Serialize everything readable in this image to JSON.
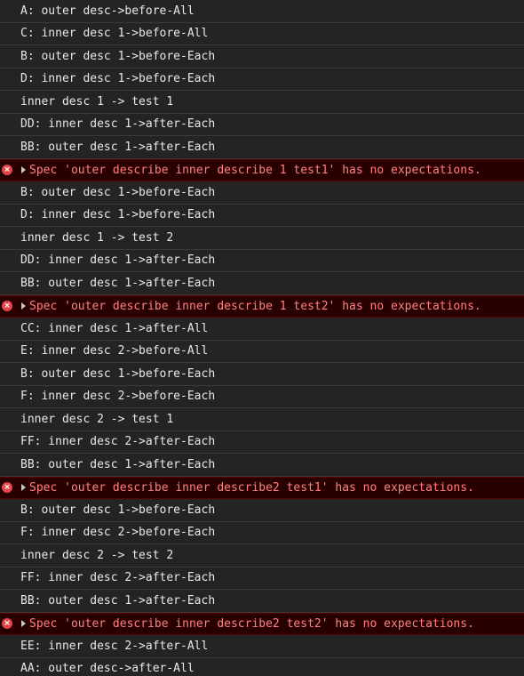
{
  "icons": {
    "error": "error-circle-icon",
    "expand": "triangle-right-icon",
    "error_glyph": "×"
  },
  "colors": {
    "background": "#242424",
    "log_text": "#e8e8e8",
    "error_background": "#290000",
    "error_text": "#ff8080",
    "error_icon": "#e0474c",
    "separator": "#3a3a3a"
  },
  "console": {
    "rows": [
      {
        "type": "log",
        "text": "A: outer desc->before-All"
      },
      {
        "type": "log",
        "text": "C: inner desc 1->before-All"
      },
      {
        "type": "log",
        "text": "B: outer desc 1->before-Each"
      },
      {
        "type": "log",
        "text": "D: inner desc 1->before-Each"
      },
      {
        "type": "log",
        "text": "inner desc 1 -> test 1"
      },
      {
        "type": "log",
        "text": "DD: inner desc 1->after-Each"
      },
      {
        "type": "log",
        "text": "BB: outer desc 1->after-Each"
      },
      {
        "type": "error",
        "text": "Spec 'outer describe inner describe 1 test1' has no expectations."
      },
      {
        "type": "log",
        "text": "B: outer desc 1->before-Each"
      },
      {
        "type": "log",
        "text": "D: inner desc 1->before-Each"
      },
      {
        "type": "log",
        "text": "inner desc 1 -> test 2"
      },
      {
        "type": "log",
        "text": "DD: inner desc 1->after-Each"
      },
      {
        "type": "log",
        "text": "BB: outer desc 1->after-Each"
      },
      {
        "type": "error",
        "text": "Spec 'outer describe inner describe 1 test2' has no expectations."
      },
      {
        "type": "log",
        "text": "CC: inner desc 1->after-All"
      },
      {
        "type": "log",
        "text": "E: inner desc 2->before-All"
      },
      {
        "type": "log",
        "text": "B: outer desc 1->before-Each"
      },
      {
        "type": "log",
        "text": "F: inner desc 2->before-Each"
      },
      {
        "type": "log",
        "text": "inner desc 2 -> test 1"
      },
      {
        "type": "log",
        "text": "FF: inner desc 2->after-Each"
      },
      {
        "type": "log",
        "text": "BB: outer desc 1->after-Each"
      },
      {
        "type": "error",
        "text": "Spec 'outer describe inner describe2 test1' has no expectations."
      },
      {
        "type": "log",
        "text": "B: outer desc 1->before-Each"
      },
      {
        "type": "log",
        "text": "F: inner desc 2->before-Each"
      },
      {
        "type": "log",
        "text": "inner desc 2 -> test 2"
      },
      {
        "type": "log",
        "text": "FF: inner desc 2->after-Each"
      },
      {
        "type": "log",
        "text": "BB: outer desc 1->after-Each"
      },
      {
        "type": "error",
        "text": "Spec 'outer describe inner describe2 test2' has no expectations."
      },
      {
        "type": "log",
        "text": "EE: inner desc 2->after-All"
      },
      {
        "type": "log",
        "text": "AA: outer desc->after-All"
      }
    ]
  }
}
